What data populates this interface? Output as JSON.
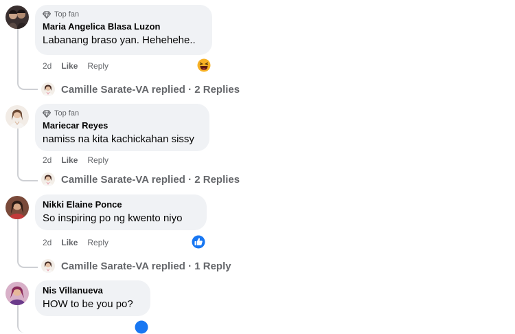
{
  "comments": [
    {
      "badge": "Top fan",
      "author": "Maria Angelica Blasa Luzon",
      "text": "Labanang braso yan. Hehehehe..",
      "time": "2d",
      "like_label": "Like",
      "reply_label": "Reply",
      "reaction": "laughing-emoji",
      "replies_text": "Camille Sarate-VA replied · 2 Replies"
    },
    {
      "badge": "Top fan",
      "author": "Mariecar Reyes",
      "text": "namiss na kita kachickahan sissy",
      "time": "2d",
      "like_label": "Like",
      "reply_label": "Reply",
      "replies_text": "Camille Sarate-VA replied · 2 Replies"
    },
    {
      "author": "Nikki Elaine Ponce",
      "text": "So inspiring po ng kwento niyo",
      "time": "2d",
      "like_label": "Like",
      "reply_label": "Reply",
      "reaction": "like-thumb",
      "replies_text": "Camille Sarate-VA replied · 1 Reply"
    },
    {
      "author": "Nis Villanueva",
      "text": "HOW to be you po?"
    }
  ],
  "colors": {
    "bubble": "#f0f2f5",
    "meta_text": "#65676b",
    "like_blue": "#1877f2",
    "thread_line": "#ced0d4"
  }
}
